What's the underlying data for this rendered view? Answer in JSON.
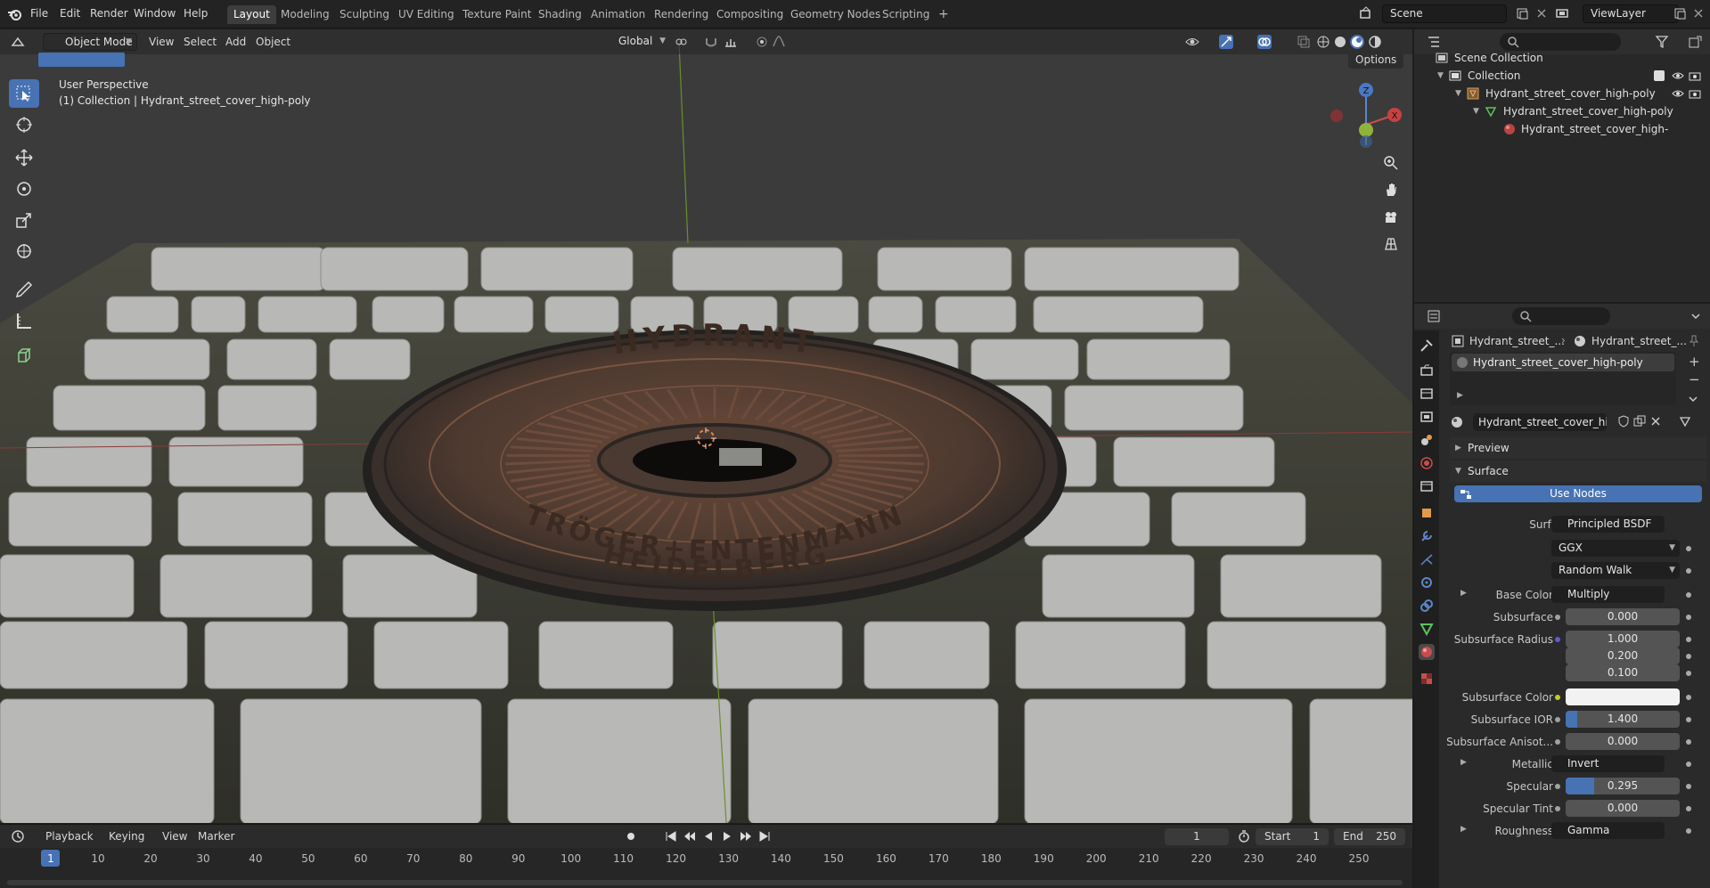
{
  "menubar": {
    "items": [
      "File",
      "Edit",
      "Render",
      "Window",
      "Help"
    ],
    "workspaces": [
      "Layout",
      "Modeling",
      "Sculpting",
      "UV Editing",
      "Texture Paint",
      "Shading",
      "Animation",
      "Rendering",
      "Compositing",
      "Geometry Nodes",
      "Scripting"
    ],
    "add_tab": "+",
    "scene": "Scene",
    "view_layer": "ViewLayer"
  },
  "viewport": {
    "mode": "Object Mode",
    "menus": [
      "View",
      "Select",
      "Add",
      "Object"
    ],
    "orientation": "Global",
    "options": "Options",
    "overlay_line1": "User Perspective",
    "overlay_line2": "(1) Collection | Hydrant_street_cover_high-poly",
    "gizmo_axes": {
      "x": "X",
      "y": "Y",
      "z": "Z"
    },
    "cover_text": {
      "top": "HYDRANT",
      "middle": "TRÖGER+ENTENMANN",
      "bottom": "HEIDELBERG"
    }
  },
  "timeline": {
    "menus": [
      "Playback",
      "Keying",
      "View",
      "Marker"
    ],
    "current_frame": "1",
    "start_label": "Start",
    "start": "1",
    "end_label": "End",
    "end": "250",
    "ruler": [
      "1",
      "10",
      "20",
      "30",
      "40",
      "50",
      "60",
      "70",
      "80",
      "90",
      "100",
      "110",
      "120",
      "130",
      "140",
      "150",
      "160",
      "170",
      "180",
      "190",
      "200",
      "210",
      "220",
      "230",
      "240",
      "250"
    ]
  },
  "outliner": {
    "scene_collection": "Scene Collection",
    "collection": "Collection",
    "object": "Hydrant_street_cover_high-poly",
    "mesh": "Hydrant_street_cover_high-poly",
    "material": "Hydrant_street_cover_high-"
  },
  "properties": {
    "breadcrumb_object": "Hydrant_street_...",
    "breadcrumb_material": "Hydrant_street_...",
    "slot_name": "Hydrant_street_cover_high-poly",
    "material_name": "Hydrant_street_cover_high-...",
    "panel_preview": "Preview",
    "panel_surface": "Surface",
    "use_nodes": "Use Nodes",
    "surface_label": "Surface",
    "surface_value": "Principled BSDF",
    "distribution": "GGX",
    "subsurface_method": "Random Walk",
    "rows": [
      {
        "label": "Base Color",
        "value": "Multiply",
        "kind": "link"
      },
      {
        "label": "Subsurface",
        "value": "0.000",
        "kind": "num"
      },
      {
        "label": "Subsurface Radius",
        "value": "1.000",
        "kind": "num"
      },
      {
        "label": "",
        "value": "0.200",
        "kind": "num"
      },
      {
        "label": "",
        "value": "0.100",
        "kind": "num"
      },
      {
        "label": "Subsurface Color",
        "value": "",
        "kind": "color"
      },
      {
        "label": "Subsurface IOR",
        "value": "1.400",
        "kind": "num"
      },
      {
        "label": "Subsurface Anisot...",
        "value": "0.000",
        "kind": "num"
      },
      {
        "label": "Metallic",
        "value": "Invert",
        "kind": "link"
      },
      {
        "label": "Specular",
        "value": "0.295",
        "kind": "num"
      },
      {
        "label": "Specular Tint",
        "value": "0.000",
        "kind": "num"
      },
      {
        "label": "Roughness",
        "value": "Gamma",
        "kind": "link"
      }
    ]
  },
  "colors": {
    "accent": "#4772b3",
    "cover_rust": "#5a3e30",
    "stone": "#b7b7b5",
    "joints": "#3b3a30"
  }
}
